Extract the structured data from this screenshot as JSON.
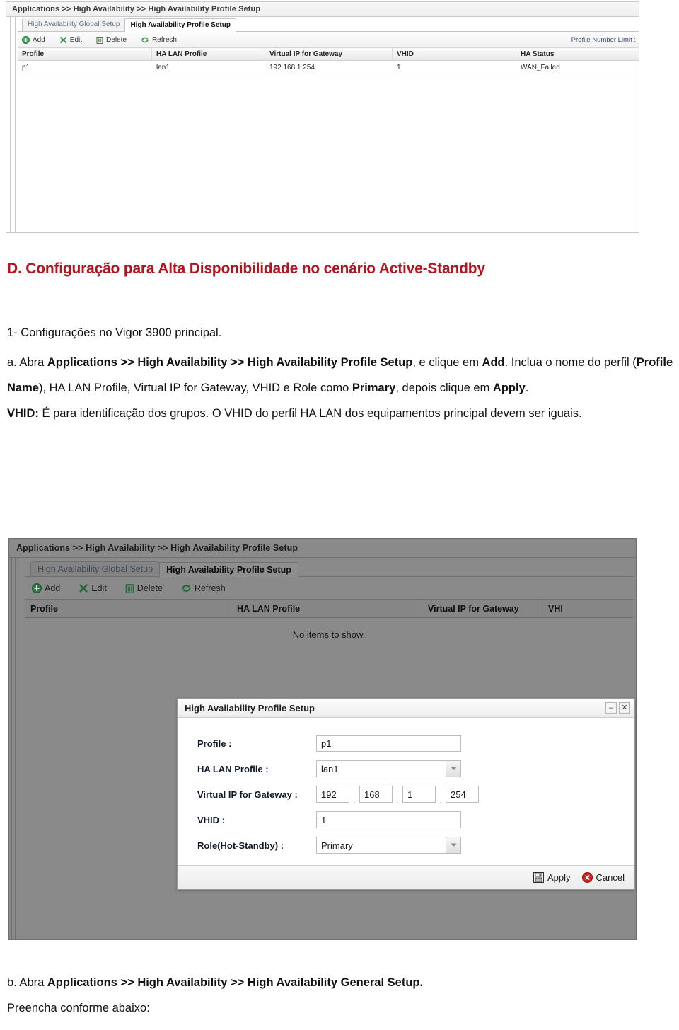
{
  "top_panel": {
    "breadcrumb": "Applications >> High Availability >> High Availability Profile Setup",
    "tabs": [
      {
        "label": "High Availability Global Setup",
        "active": false
      },
      {
        "label": "High Availability Profile Setup",
        "active": true
      }
    ],
    "toolbar": {
      "add": "Add",
      "edit": "Edit",
      "delete": "Delete",
      "refresh": "Refresh",
      "profile_number_limit": "Profile Number Limit :"
    },
    "table": {
      "headers": [
        "Profile",
        "HA LAN Profile",
        "Virtual IP for Gateway",
        "VHID",
        "HA Status"
      ],
      "rows": [
        {
          "profile": "p1",
          "ha_lan_profile": "lan1",
          "virtual_ip": "192.168.1.254",
          "vhid": "1",
          "ha_status": "WAN_Failed"
        }
      ]
    }
  },
  "prose": {
    "heading": "D. Configuração para Alta Disponibilidade no cenário Active-Standby",
    "line1": "1- Configurações no Vigor 3900 principal.",
    "p_a": {
      "s1": "a. Abra ",
      "b1": "Applications >> High Availability >> High Availability Profile Setup",
      "s2": ", e clique em ",
      "b2": "Add",
      "s3": ". Inclua o nome do perfil (",
      "b3": "Profile Name",
      "s4": "), HA LAN Profile, Virtual IP for Gateway, VHID e Role como ",
      "b4": "Primary",
      "s5": ", depois clique em ",
      "b5": "Apply",
      "s6": "."
    },
    "p_vhid": {
      "b1": "VHID:",
      "s1": " É para identificação dos grupos. O VHID do perfil HA LAN dos equipamentos principal devem ser iguais."
    },
    "p_b": {
      "s1": "b. Abra ",
      "b1": "Applications >> High Availability >> High Availability General Setup.",
      "s2": ""
    },
    "line_last": "Preencha conforme abaixo:"
  },
  "bottom_panel": {
    "breadcrumb": "Applications >> High Availability >> High Availability Profile Setup",
    "tabs": [
      {
        "label": "High Availability Global Setup",
        "active": false
      },
      {
        "label": "High Availability Profile Setup",
        "active": true
      }
    ],
    "toolbar": {
      "add": "Add",
      "edit": "Edit",
      "delete": "Delete",
      "refresh": "Refresh"
    },
    "table": {
      "headers": [
        "Profile",
        "HA LAN Profile",
        "Virtual IP for Gateway",
        "VHI"
      ],
      "empty_text": "No items to show."
    }
  },
  "dialog": {
    "title": "High Availability Profile Setup",
    "minimize_glyph": "–",
    "close_glyph": "✕",
    "fields": {
      "profile_label": "Profile :",
      "profile_value": "p1",
      "ha_lan_label": "HA LAN Profile :",
      "ha_lan_value": "lan1",
      "vip_label": "Virtual IP for Gateway :",
      "vip_o1": "192",
      "vip_o2": "168",
      "vip_o3": "1",
      "vip_o4": "254",
      "dot": ".",
      "vhid_label": "VHID :",
      "vhid_value": "1",
      "role_label": "Role(Hot-Standby) :",
      "role_value": "Primary"
    },
    "footer": {
      "apply": "Apply",
      "cancel": "Cancel"
    }
  },
  "colors": {
    "heading_red": "#b31420",
    "icon_green": "#2e8b45",
    "tab_inactive_blue": "#5f7590",
    "dim_gray": "#8a8a8a",
    "cancel_red": "#cc2222"
  }
}
